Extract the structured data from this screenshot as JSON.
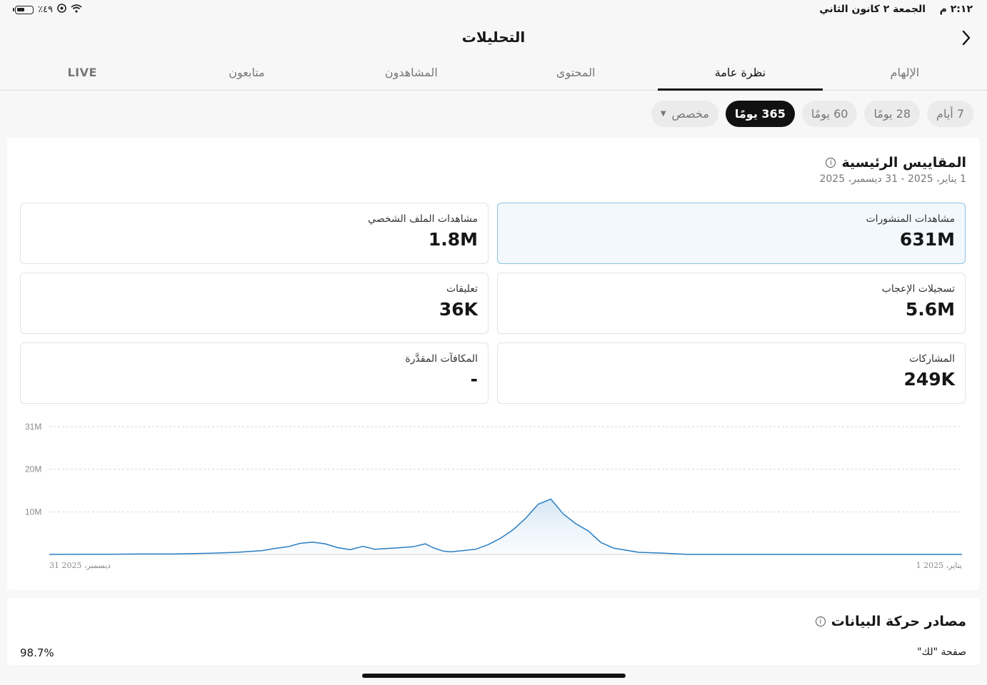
{
  "status_bar": {
    "time": "٢:١٢ م",
    "date": "الجمعة ٢ كانون الثاني",
    "battery": "٪٤٩"
  },
  "header": {
    "title": "التحليلات"
  },
  "tabs": [
    {
      "label": "الإلهام",
      "active": false
    },
    {
      "label": "نظرة عامة",
      "active": true
    },
    {
      "label": "المحتوى",
      "active": false
    },
    {
      "label": "المشاهدون",
      "active": false
    },
    {
      "label": "متابعون",
      "active": false
    },
    {
      "label": "LIVE",
      "active": false
    }
  ],
  "ranges": [
    {
      "label": "7 أيام",
      "active": false
    },
    {
      "label": "28 يومًا",
      "active": false
    },
    {
      "label": "60 يومًا",
      "active": false
    },
    {
      "label": "365 يومًا",
      "active": true
    },
    {
      "label": "مخصص",
      "active": false
    }
  ],
  "key_metrics": {
    "title": "المقاييس الرئيسية",
    "date_range": "1 يناير، 2025 - 31 ديسمبر، 2025",
    "items": [
      {
        "label": "مشاهدات المنشورات",
        "value": "631M",
        "selected": true
      },
      {
        "label": "مشاهدات الملف الشخصي",
        "value": "1.8M",
        "selected": false
      },
      {
        "label": "تسجيلات الإعجاب",
        "value": "5.6M",
        "selected": false
      },
      {
        "label": "تعليقات",
        "value": "36K",
        "selected": false
      },
      {
        "label": "المشاركات",
        "value": "249K",
        "selected": false
      },
      {
        "label": "المكافآت المقدَّرة",
        "value": "-",
        "selected": false
      }
    ]
  },
  "chart_data": {
    "type": "area",
    "y_ticks": [
      "31M",
      "20M",
      "10M"
    ],
    "y_tick_values": [
      30,
      20,
      10
    ],
    "ylim": [
      0,
      30
    ],
    "x_tick_start": "1 يناير، 2025",
    "x_tick_end": "31 ديسمبر، 2025",
    "x_direction": "right-to-left",
    "x_unit": "day of year",
    "color": "#2b7ec2",
    "grid": true,
    "series": [
      {
        "x": [
          1,
          60,
          90,
          100,
          110,
          120,
          130,
          140,
          145,
          150,
          155,
          160,
          165,
          170,
          175,
          180,
          185,
          190,
          195,
          200,
          205,
          208,
          212,
          215,
          220,
          225,
          230,
          235,
          240,
          245,
          250,
          255,
          260,
          265,
          270,
          275,
          280,
          290,
          300,
          315,
          330,
          340,
          350,
          358,
          365
        ],
        "y": [
          0,
          0,
          0,
          0,
          0,
          0.3,
          0.5,
          1.5,
          2.8,
          5.5,
          7.2,
          9.5,
          13,
          11.8,
          8.5,
          5.8,
          3.8,
          2.3,
          1.2,
          0.9,
          0.6,
          0.8,
          1.6,
          2.5,
          1.8,
          1.6,
          1.4,
          1.2,
          1.9,
          1.1,
          1.6,
          2.5,
          2.9,
          2.6,
          1.8,
          1.4,
          0.9,
          0.5,
          0.3,
          0.1,
          0.1,
          0.05,
          0.03,
          0.02,
          0
        ]
      }
    ]
  },
  "traffic_sources": {
    "title": "مصادر حركة البيانات",
    "rows": [
      {
        "label": "صفحة \"لك\"",
        "value": "98.7%"
      }
    ]
  }
}
